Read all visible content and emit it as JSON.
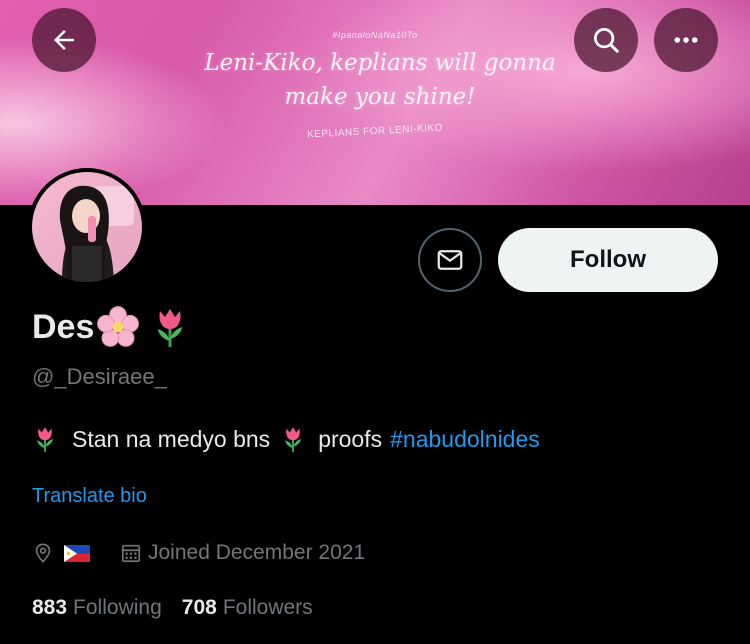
{
  "banner": {
    "hashtag": "#IpanaloNaNa10To",
    "quote_line1": "Leni-Kiko, keplians will gonna",
    "quote_line2": "make you shine!",
    "credit": "KEPLIANS FOR LENI-KIKO"
  },
  "toolbar": {
    "back_icon": "arrow-left-icon",
    "search_icon": "search-icon",
    "more_icon": "more-horizontal-icon"
  },
  "profile": {
    "display_name": "Des",
    "name_emojis": [
      "cherry-blossom",
      "tulip"
    ],
    "handle": "@_Desiraee_",
    "bio_text1": "Stan na medyo bns",
    "bio_text2": "proofs",
    "bio_hashtag": "#nabudolnides",
    "translate_label": "Translate bio",
    "joined": "Joined December 2021",
    "location_flag": "Philippines flag",
    "following_count": "883",
    "following_label": "Following",
    "followers_count": "708",
    "followers_label": "Followers"
  },
  "actions": {
    "follow_label": "Follow",
    "message_icon": "envelope-icon"
  },
  "colors": {
    "accent": "#1d9bf0",
    "background": "#000000",
    "follow_bg": "#eff3f4",
    "secondary_text": "#71767b",
    "banner_pink": "#e25fae"
  }
}
